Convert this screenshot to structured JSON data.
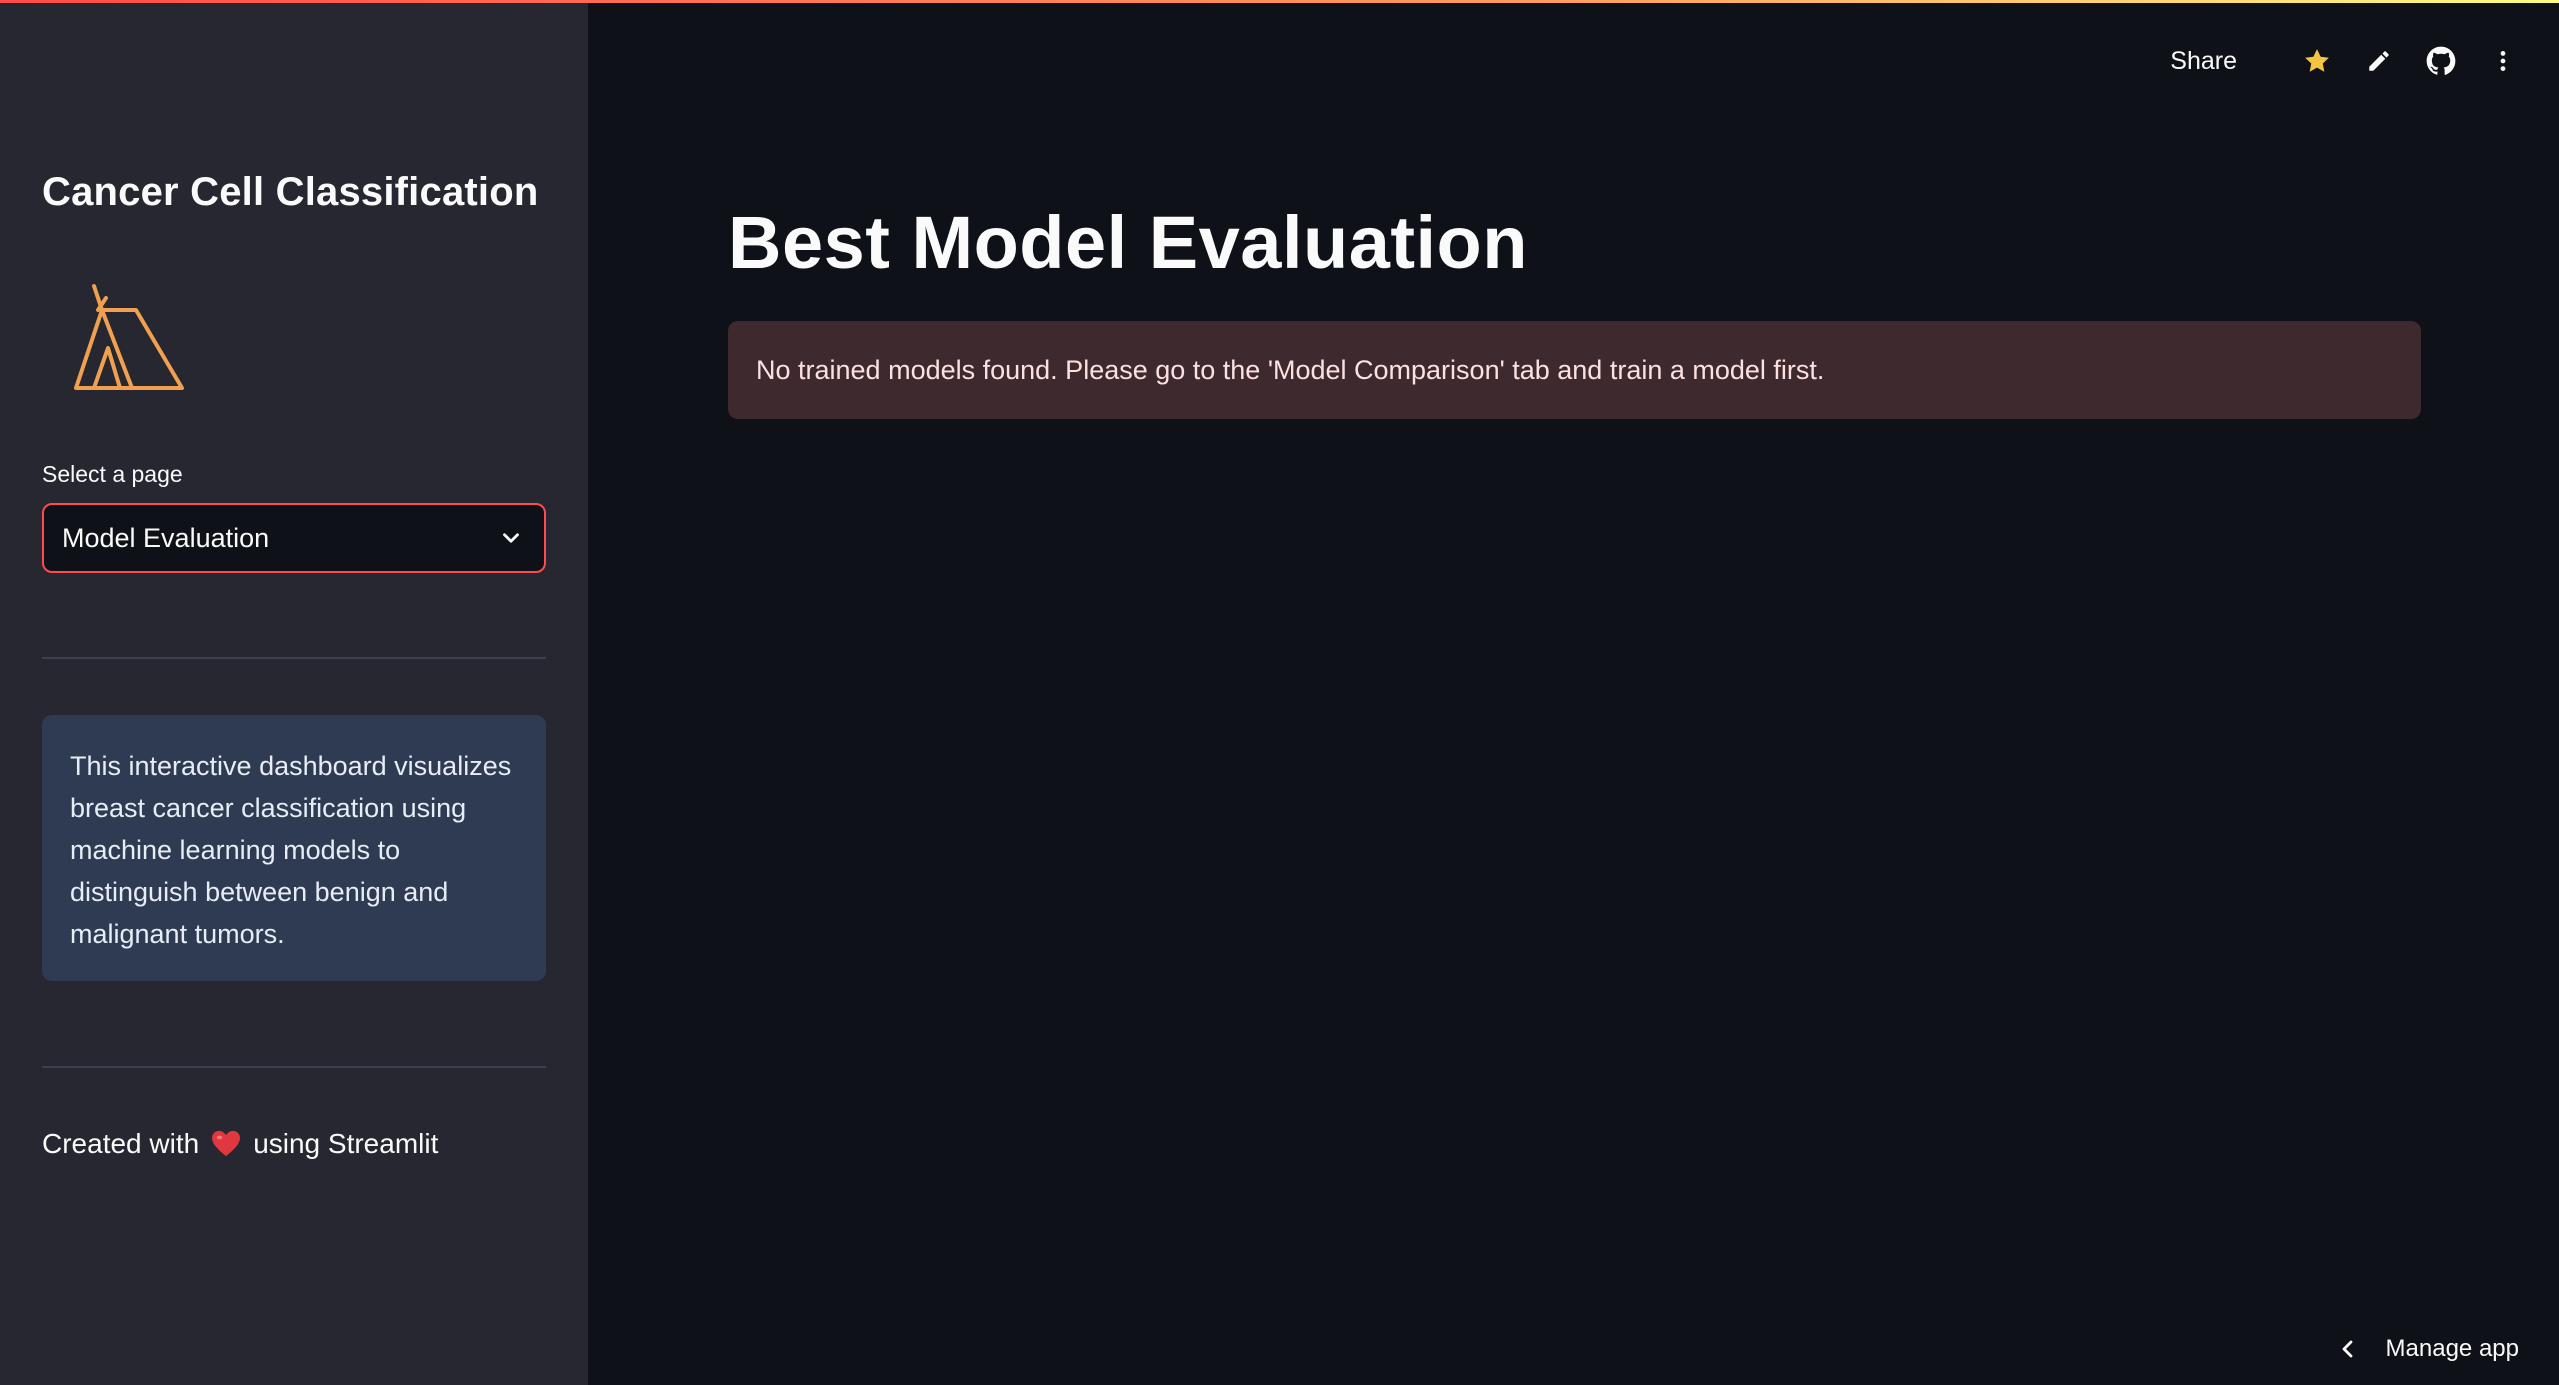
{
  "sidebar": {
    "title": "Cancer Cell Classification",
    "select_label": "Select a page",
    "selected_page": "Model Evaluation",
    "info_text": "This interactive dashboard visualizes breast cancer classification using machine learning models to distinguish between benign and malignant tumors.",
    "footer_prefix": "Created with",
    "footer_suffix": "using Streamlit"
  },
  "toolbar": {
    "share_label": "Share",
    "icons": [
      "star-icon",
      "pencil-icon",
      "github-icon",
      "more-vertical-icon"
    ]
  },
  "main": {
    "title": "Best Model Evaluation",
    "alert_text": "No trained models found. Please go to the 'Model Comparison' tab and train a model first."
  },
  "manage_app_label": "Manage app",
  "colors": {
    "background": "#0e1117",
    "sidebar": "#262730",
    "accent": "#ff4b4b",
    "info_bg": "#2f3b52",
    "alert_bg": "#3e2a2e",
    "star": "#f5c542",
    "logo": "#f0a050"
  }
}
